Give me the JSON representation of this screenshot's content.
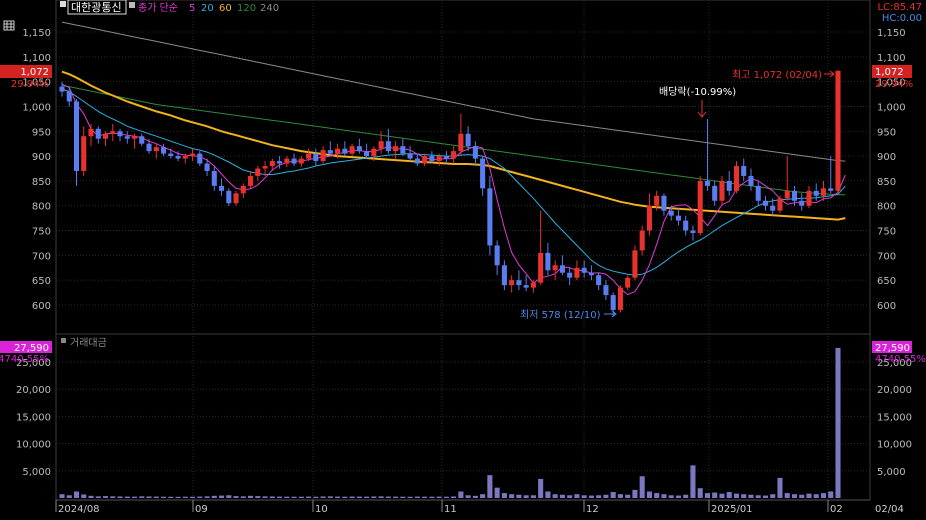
{
  "header": {
    "stock_name": "대한광통신",
    "indicator_label": "종가 단순",
    "ma_periods": [
      "5",
      "20",
      "60",
      "120",
      "240"
    ],
    "lc_label": "LC:85.47",
    "hc_label": "HC:0.00"
  },
  "colors": {
    "up": "#e8322e",
    "down": "#5b7df2",
    "ma5": "#e03bd8",
    "ma20": "#29b2e4",
    "ma60": "#f2b21c",
    "ma120": "#2e8b3a",
    "ma240": "#8a8a8a",
    "current_tag_bg": "#d42222",
    "volume_tag_bg": "#d923d9",
    "volume_bar": "#7a78c0"
  },
  "price_panel": {
    "y_ticks": [
      "1,150",
      "1,100",
      "1,050",
      "1,000",
      "950",
      "900",
      "850",
      "800",
      "750",
      "700",
      "650",
      "600"
    ],
    "current_value": "1,072",
    "current_pct": "29.94%",
    "high_annotation": "최고 1,072 (02/04)",
    "low_annotation": "최저 578 (12/10)",
    "dividend_annotation": "배당락(-10.99%)"
  },
  "volume_panel": {
    "title": "거래대금",
    "y_ticks": [
      "25,000",
      "20,000",
      "15,000",
      "10,000",
      "5,000"
    ],
    "current_value": "27,590",
    "current_pct": "4740.55%"
  },
  "x_axis": {
    "labels": [
      "2024/08",
      "09",
      "10",
      "11",
      "12",
      "2025/01",
      "02",
      "02/04"
    ]
  },
  "chart_data": {
    "type": "candlestick",
    "price_range": [
      540,
      1180
    ],
    "volume_range": [
      0,
      28000
    ],
    "candles": [
      {
        "o": 1040,
        "h": 1050,
        "l": 1020,
        "c": 1030
      },
      {
        "o": 1030,
        "h": 1040,
        "l": 1000,
        "c": 1010
      },
      {
        "o": 1010,
        "h": 1015,
        "l": 840,
        "c": 870
      },
      {
        "o": 870,
        "h": 960,
        "l": 860,
        "c": 940
      },
      {
        "o": 940,
        "h": 965,
        "l": 920,
        "c": 955
      },
      {
        "o": 955,
        "h": 960,
        "l": 925,
        "c": 935
      },
      {
        "o": 935,
        "h": 950,
        "l": 920,
        "c": 945
      },
      {
        "o": 945,
        "h": 965,
        "l": 930,
        "c": 950
      },
      {
        "o": 950,
        "h": 955,
        "l": 930,
        "c": 940
      },
      {
        "o": 940,
        "h": 950,
        "l": 925,
        "c": 935
      },
      {
        "o": 935,
        "h": 945,
        "l": 915,
        "c": 940
      },
      {
        "o": 940,
        "h": 945,
        "l": 920,
        "c": 925
      },
      {
        "o": 925,
        "h": 935,
        "l": 905,
        "c": 910
      },
      {
        "o": 910,
        "h": 925,
        "l": 895,
        "c": 918
      },
      {
        "o": 918,
        "h": 925,
        "l": 900,
        "c": 905
      },
      {
        "o": 905,
        "h": 915,
        "l": 895,
        "c": 900
      },
      {
        "o": 900,
        "h": 910,
        "l": 890,
        "c": 895
      },
      {
        "o": 895,
        "h": 905,
        "l": 885,
        "c": 900
      },
      {
        "o": 900,
        "h": 915,
        "l": 890,
        "c": 905
      },
      {
        "o": 905,
        "h": 910,
        "l": 880,
        "c": 885
      },
      {
        "o": 885,
        "h": 895,
        "l": 860,
        "c": 870
      },
      {
        "o": 870,
        "h": 880,
        "l": 830,
        "c": 840
      },
      {
        "o": 840,
        "h": 855,
        "l": 820,
        "c": 830
      },
      {
        "o": 830,
        "h": 835,
        "l": 800,
        "c": 805
      },
      {
        "o": 805,
        "h": 830,
        "l": 800,
        "c": 825
      },
      {
        "o": 825,
        "h": 845,
        "l": 815,
        "c": 840
      },
      {
        "o": 840,
        "h": 870,
        "l": 835,
        "c": 860
      },
      {
        "o": 860,
        "h": 880,
        "l": 850,
        "c": 875
      },
      {
        "o": 875,
        "h": 890,
        "l": 860,
        "c": 880
      },
      {
        "o": 880,
        "h": 895,
        "l": 870,
        "c": 890
      },
      {
        "o": 890,
        "h": 900,
        "l": 875,
        "c": 885
      },
      {
        "o": 885,
        "h": 900,
        "l": 878,
        "c": 895
      },
      {
        "o": 895,
        "h": 905,
        "l": 880,
        "c": 885
      },
      {
        "o": 885,
        "h": 900,
        "l": 878,
        "c": 895
      },
      {
        "o": 895,
        "h": 915,
        "l": 890,
        "c": 905
      },
      {
        "o": 905,
        "h": 915,
        "l": 880,
        "c": 890
      },
      {
        "o": 890,
        "h": 920,
        "l": 885,
        "c": 912
      },
      {
        "o": 912,
        "h": 930,
        "l": 900,
        "c": 905
      },
      {
        "o": 905,
        "h": 925,
        "l": 895,
        "c": 915
      },
      {
        "o": 915,
        "h": 930,
        "l": 900,
        "c": 905
      },
      {
        "o": 905,
        "h": 925,
        "l": 900,
        "c": 920
      },
      {
        "o": 920,
        "h": 935,
        "l": 905,
        "c": 910
      },
      {
        "o": 910,
        "h": 925,
        "l": 895,
        "c": 900
      },
      {
        "o": 900,
        "h": 920,
        "l": 890,
        "c": 915
      },
      {
        "o": 915,
        "h": 950,
        "l": 905,
        "c": 930
      },
      {
        "o": 930,
        "h": 955,
        "l": 905,
        "c": 910
      },
      {
        "o": 910,
        "h": 930,
        "l": 895,
        "c": 920
      },
      {
        "o": 920,
        "h": 935,
        "l": 900,
        "c": 905
      },
      {
        "o": 905,
        "h": 920,
        "l": 890,
        "c": 895
      },
      {
        "o": 895,
        "h": 905,
        "l": 880,
        "c": 885
      },
      {
        "o": 885,
        "h": 905,
        "l": 880,
        "c": 900
      },
      {
        "o": 900,
        "h": 910,
        "l": 885,
        "c": 890
      },
      {
        "o": 890,
        "h": 905,
        "l": 880,
        "c": 900
      },
      {
        "o": 900,
        "h": 910,
        "l": 885,
        "c": 895
      },
      {
        "o": 895,
        "h": 920,
        "l": 885,
        "c": 910
      },
      {
        "o": 910,
        "h": 985,
        "l": 900,
        "c": 945
      },
      {
        "o": 945,
        "h": 960,
        "l": 910,
        "c": 920
      },
      {
        "o": 920,
        "h": 930,
        "l": 880,
        "c": 895
      },
      {
        "o": 895,
        "h": 900,
        "l": 820,
        "c": 835
      },
      {
        "o": 835,
        "h": 860,
        "l": 700,
        "c": 720
      },
      {
        "o": 720,
        "h": 730,
        "l": 660,
        "c": 680
      },
      {
        "o": 680,
        "h": 690,
        "l": 630,
        "c": 640
      },
      {
        "o": 640,
        "h": 660,
        "l": 625,
        "c": 650
      },
      {
        "o": 650,
        "h": 670,
        "l": 630,
        "c": 640
      },
      {
        "o": 640,
        "h": 660,
        "l": 628,
        "c": 635
      },
      {
        "o": 635,
        "h": 650,
        "l": 625,
        "c": 645
      },
      {
        "o": 645,
        "h": 790,
        "l": 640,
        "c": 705
      },
      {
        "o": 705,
        "h": 725,
        "l": 660,
        "c": 670
      },
      {
        "o": 670,
        "h": 690,
        "l": 650,
        "c": 680
      },
      {
        "o": 680,
        "h": 700,
        "l": 660,
        "c": 665
      },
      {
        "o": 665,
        "h": 675,
        "l": 640,
        "c": 655
      },
      {
        "o": 655,
        "h": 690,
        "l": 650,
        "c": 675
      },
      {
        "o": 675,
        "h": 690,
        "l": 655,
        "c": 665
      },
      {
        "o": 665,
        "h": 680,
        "l": 650,
        "c": 660
      },
      {
        "o": 660,
        "h": 665,
        "l": 630,
        "c": 640
      },
      {
        "o": 640,
        "h": 650,
        "l": 610,
        "c": 620
      },
      {
        "o": 620,
        "h": 625,
        "l": 578,
        "c": 590
      },
      {
        "o": 590,
        "h": 640,
        "l": 585,
        "c": 635
      },
      {
        "o": 635,
        "h": 660,
        "l": 630,
        "c": 655
      },
      {
        "o": 655,
        "h": 720,
        "l": 650,
        "c": 710
      },
      {
        "o": 710,
        "h": 760,
        "l": 700,
        "c": 750
      },
      {
        "o": 750,
        "h": 825,
        "l": 740,
        "c": 800
      },
      {
        "o": 800,
        "h": 830,
        "l": 790,
        "c": 820
      },
      {
        "o": 820,
        "h": 825,
        "l": 780,
        "c": 790
      },
      {
        "o": 790,
        "h": 800,
        "l": 770,
        "c": 780
      },
      {
        "o": 780,
        "h": 795,
        "l": 760,
        "c": 770
      },
      {
        "o": 770,
        "h": 780,
        "l": 740,
        "c": 750
      },
      {
        "o": 750,
        "h": 760,
        "l": 730,
        "c": 745
      },
      {
        "o": 745,
        "h": 860,
        "l": 740,
        "c": 850
      },
      {
        "o": 850,
        "h": 975,
        "l": 830,
        "c": 840
      },
      {
        "o": 840,
        "h": 850,
        "l": 800,
        "c": 810
      },
      {
        "o": 810,
        "h": 860,
        "l": 800,
        "c": 850
      },
      {
        "o": 850,
        "h": 870,
        "l": 820,
        "c": 830
      },
      {
        "o": 830,
        "h": 890,
        "l": 825,
        "c": 880
      },
      {
        "o": 880,
        "h": 895,
        "l": 850,
        "c": 860
      },
      {
        "o": 860,
        "h": 875,
        "l": 830,
        "c": 840
      },
      {
        "o": 840,
        "h": 850,
        "l": 800,
        "c": 810
      },
      {
        "o": 810,
        "h": 820,
        "l": 790,
        "c": 800
      },
      {
        "o": 800,
        "h": 815,
        "l": 780,
        "c": 790
      },
      {
        "o": 790,
        "h": 820,
        "l": 785,
        "c": 815
      },
      {
        "o": 815,
        "h": 900,
        "l": 810,
        "c": 830
      },
      {
        "o": 830,
        "h": 840,
        "l": 800,
        "c": 810
      },
      {
        "o": 810,
        "h": 825,
        "l": 790,
        "c": 800
      },
      {
        "o": 800,
        "h": 840,
        "l": 795,
        "c": 830
      },
      {
        "o": 830,
        "h": 845,
        "l": 810,
        "c": 820
      },
      {
        "o": 820,
        "h": 850,
        "l": 810,
        "c": 835
      },
      {
        "o": 835,
        "h": 900,
        "l": 825,
        "c": 830
      },
      {
        "o": 830,
        "h": 1072,
        "l": 825,
        "c": 1072
      }
    ],
    "volume": [
      700,
      500,
      1200,
      650,
      400,
      300,
      350,
      300,
      280,
      260,
      250,
      300,
      280,
      260,
      240,
      230,
      220,
      240,
      230,
      260,
      300,
      400,
      450,
      500,
      350,
      300,
      400,
      350,
      300,
      280,
      260,
      250,
      240,
      240,
      260,
      230,
      280,
      300,
      260,
      240,
      270,
      260,
      250,
      280,
      300,
      260,
      250,
      240,
      230,
      260,
      250,
      240,
      250,
      240,
      280,
      1200,
      500,
      400,
      700,
      4200,
      1900,
      900,
      700,
      600,
      500,
      500,
      3500,
      1200,
      700,
      600,
      500,
      700,
      500,
      450,
      500,
      600,
      1100,
      700,
      600,
      1500,
      4000,
      1200,
      900,
      700,
      500,
      450,
      600,
      6000,
      1800,
      900,
      1000,
      800,
      1100,
      800,
      700,
      600,
      500,
      450,
      700,
      3700,
      900,
      700,
      600,
      800,
      700,
      900,
      1200,
      27590
    ],
    "ma5": [
      1045,
      1038,
      1005,
      985,
      955,
      940,
      945,
      946,
      945,
      942,
      940,
      937,
      930,
      925,
      918,
      912,
      905,
      902,
      901,
      899,
      892,
      880,
      864,
      848,
      835,
      832,
      834,
      842,
      856,
      872,
      882,
      887,
      890,
      890,
      893,
      896,
      898,
      900,
      905,
      907,
      911,
      911,
      909,
      909,
      914,
      919,
      914,
      915,
      912,
      904,
      897,
      893,
      894,
      895,
      895,
      908,
      914,
      920,
      916,
      875,
      813,
      755,
      706,
      681,
      663,
      644,
      655,
      658,
      663,
      677,
      675,
      670,
      669,
      664,
      665,
      662,
      650,
      633,
      621,
      627,
      650,
      681,
      722,
      768,
      798,
      801,
      802,
      792,
      777,
      760,
      780,
      802,
      809,
      834,
      846,
      855,
      850,
      840,
      830,
      814,
      803,
      806,
      808,
      808,
      806,
      814,
      816,
      827,
      862
    ],
    "ma20": [
      1035,
      1030,
      1020,
      1010,
      1000,
      990,
      982,
      975,
      968,
      960,
      955,
      950,
      945,
      940,
      935,
      930,
      925,
      920,
      915,
      912,
      908,
      902,
      895,
      888,
      880,
      872,
      868,
      865,
      863,
      863,
      865,
      868,
      870,
      873,
      876,
      880,
      883,
      886,
      888,
      890,
      892,
      894,
      896,
      898,
      900,
      902,
      903,
      904,
      905,
      904,
      903,
      902,
      901,
      900,
      900,
      902,
      903,
      902,
      900,
      895,
      885,
      875,
      860,
      845,
      830,
      815,
      798,
      782,
      765,
      750,
      735,
      720,
      705,
      690,
      680,
      673,
      668,
      665,
      662,
      660,
      662,
      668,
      676,
      686,
      697,
      707,
      716,
      724,
      731,
      740,
      750,
      760,
      768,
      776,
      784,
      792,
      800,
      806,
      810,
      812,
      813,
      814,
      815,
      815,
      816,
      818,
      820,
      823,
      840
    ],
    "ma60": [
      1070,
      1065,
      1058,
      1050,
      1042,
      1035,
      1028,
      1022,
      1016,
      1010,
      1005,
      1000,
      995,
      990,
      986,
      982,
      977,
      972,
      968,
      964,
      960,
      955,
      950,
      946,
      942,
      938,
      934,
      930,
      926,
      922,
      919,
      916,
      913,
      910,
      908,
      906,
      904,
      902,
      900,
      899,
      898,
      897,
      896,
      895,
      894,
      893,
      892,
      891,
      890,
      889,
      888,
      887,
      886,
      885,
      884,
      884,
      884,
      883,
      882,
      880,
      876,
      872,
      868,
      864,
      860,
      856,
      852,
      848,
      844,
      840,
      836,
      832,
      828,
      824,
      820,
      816,
      812,
      808,
      805,
      802,
      800,
      798,
      797,
      796,
      795,
      794,
      793,
      792,
      791,
      790,
      789,
      788,
      787,
      786,
      785,
      784,
      783,
      782,
      781,
      780,
      779,
      778,
      777,
      776,
      775,
      774,
      773,
      772,
      775
    ],
    "ma120": [
      1042,
      1040,
      1037,
      1034,
      1031,
      1028,
      1025,
      1022,
      1019,
      1016,
      1013,
      1010,
      1007,
      1004,
      1002,
      1000,
      998,
      996,
      994,
      992,
      990,
      988,
      986,
      984,
      982,
      980,
      978,
      976,
      974,
      972,
      970,
      968,
      966,
      964,
      962,
      960,
      958,
      956,
      954,
      952,
      950,
      948,
      946,
      944,
      942,
      940,
      938,
      936,
      934,
      932,
      930,
      928,
      926,
      924,
      922,
      920,
      918,
      916,
      914,
      912,
      910,
      908,
      906,
      904,
      902,
      900,
      898,
      896,
      894,
      892,
      890,
      888,
      886,
      884,
      882,
      880,
      878,
      876,
      874,
      872,
      870,
      868,
      866,
      864,
      862,
      860,
      858,
      856,
      854,
      852,
      850,
      848,
      846,
      844,
      842,
      840,
      838,
      836,
      834,
      832,
      830,
      828,
      827,
      826,
      825,
      824,
      823,
      822,
      822
    ],
    "ma240": [
      1170,
      1167,
      1164,
      1161,
      1158,
      1155,
      1152,
      1149,
      1146,
      1143,
      1140,
      1137,
      1134,
      1131,
      1128,
      1125,
      1122,
      1119,
      1116,
      1113,
      1110,
      1107,
      1104,
      1101,
      1098,
      1095,
      1092,
      1089,
      1086,
      1083,
      1080,
      1077,
      1074,
      1071,
      1068,
      1065,
      1062,
      1059,
      1056,
      1053,
      1050,
      1047,
      1044,
      1041,
      1038,
      1035,
      1032,
      1029,
      1026,
      1023,
      1020,
      1017,
      1014,
      1011,
      1008,
      1005,
      1002,
      999,
      996,
      993,
      990,
      987,
      984,
      981,
      978,
      975,
      973,
      971,
      969,
      967,
      965,
      963,
      961,
      959,
      957,
      955,
      953,
      951,
      949,
      947,
      945,
      943,
      941,
      939,
      937,
      935,
      933,
      931,
      929,
      927,
      925,
      923,
      921,
      919,
      917,
      915,
      913,
      911,
      909,
      907,
      905,
      903,
      901,
      899,
      897,
      895,
      893,
      891,
      890
    ]
  }
}
